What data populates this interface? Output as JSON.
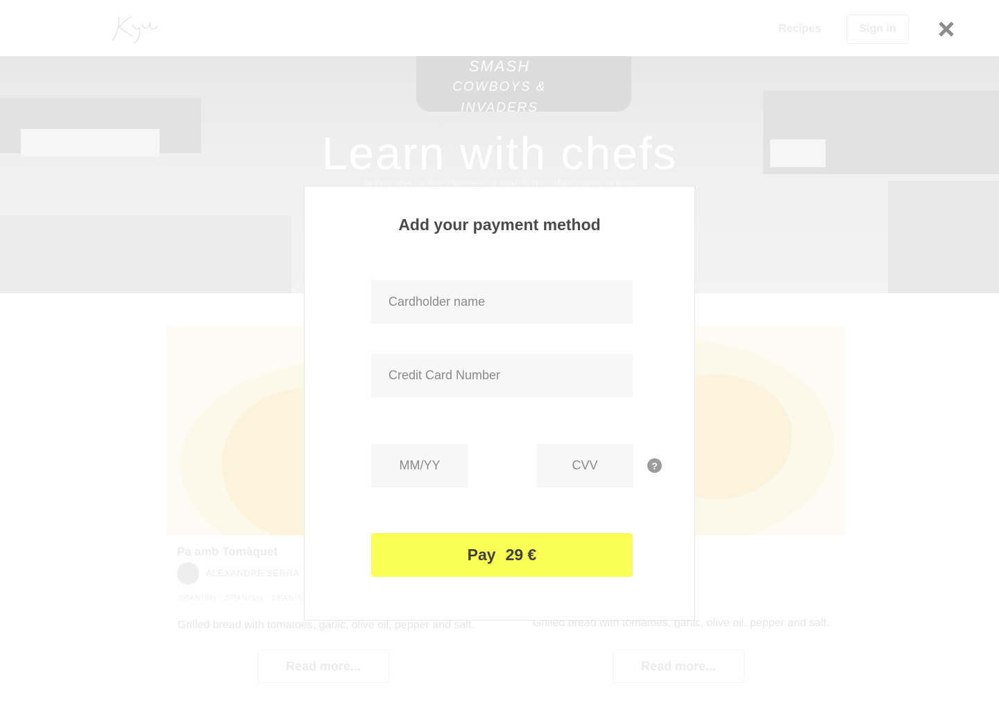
{
  "header": {
    "logo_text": "Kyd",
    "nav_recipes": "Recipes",
    "sign_in": "Sign in"
  },
  "hero": {
    "sign_text_1": "SMASH",
    "sign_text_2": "COWBOYS & INVADERS",
    "title": "Learn with chefs",
    "subtitle": "Subscribe to live classes or watch the after class videos"
  },
  "cards": [
    {
      "title": "Pa amb Tomàquet",
      "chef": "ALEXANDRE SERRA",
      "tags": "SPANISH   ·   SPANISH   ·   SPANISH",
      "description": "Grilled bread with tomatoes, garlic, olive oil, pepper and salt.",
      "read_more": "Read more..."
    },
    {
      "title": "",
      "chef": "",
      "tags": "",
      "description": "Grilled bread with tomatoes, garlic, olive oil, pepper and salt.",
      "read_more": "Read more..."
    }
  ],
  "modal": {
    "title": "Add your payment method",
    "cardholder_placeholder": "Cardholder name",
    "card_number_placeholder": "Credit Card Number",
    "expiry_placeholder": "MM/YY",
    "cvv_placeholder": "CVV",
    "help_glyph": "?",
    "pay_label": "Pay",
    "pay_amount": "29 €",
    "accent_color": "#fbff54"
  },
  "icons": {
    "close": "close-icon",
    "help": "question-circle-icon"
  }
}
